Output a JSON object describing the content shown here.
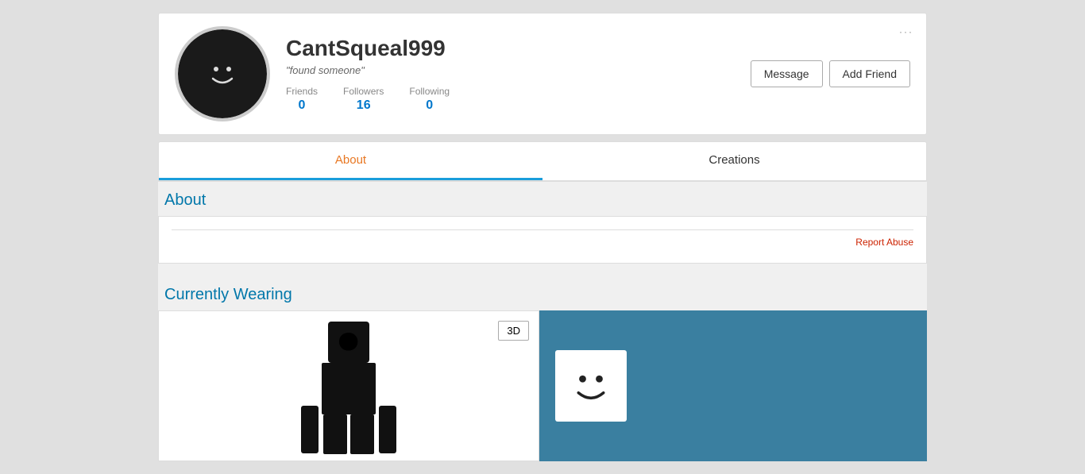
{
  "profile": {
    "username": "CantSqueal999",
    "status": "\"found someone\"",
    "stats": {
      "friends_label": "Friends",
      "friends_value": "0",
      "followers_label": "Followers",
      "followers_value": "16",
      "following_label": "Following",
      "following_value": "0"
    },
    "actions": {
      "message_label": "Message",
      "add_friend_label": "Add Friend"
    },
    "more_options": "···"
  },
  "tabs": [
    {
      "id": "about",
      "label": "About",
      "active": true
    },
    {
      "id": "creations",
      "label": "Creations",
      "active": false
    }
  ],
  "about": {
    "heading": "About",
    "report_abuse": "Report Abuse"
  },
  "currently_wearing": {
    "heading": "Currently Wearing",
    "btn_3d": "3D",
    "item_emoji": "🙂"
  }
}
